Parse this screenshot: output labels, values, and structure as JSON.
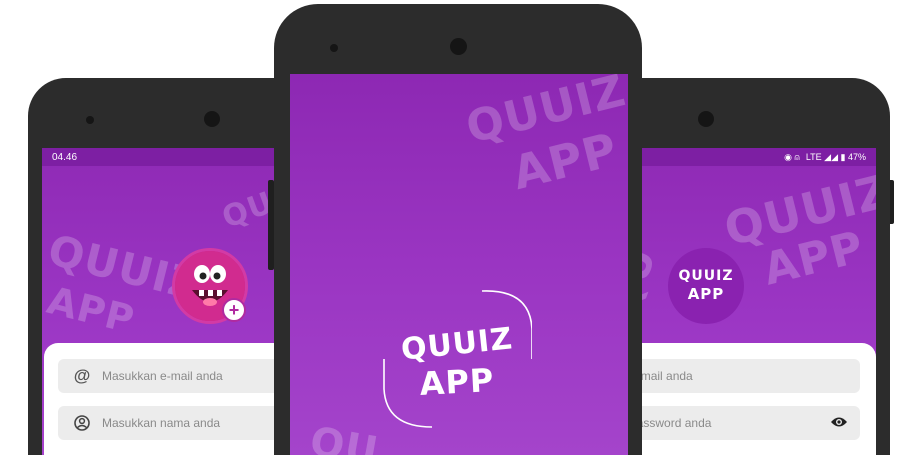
{
  "left_phone": {
    "status_time": "04.46",
    "email_placeholder": "Masukkan e-mail anda",
    "name_placeholder": "Masukkan nama anda"
  },
  "center_phone": {
    "logo_line1": "QUUIZ",
    "logo_line2": "APP",
    "watermark_line1": "QUUIZ",
    "watermark_line2": "APP"
  },
  "right_phone": {
    "status_right": "LTE ◢◢ ▮ 47%",
    "logo_line1": "QUUIZ",
    "logo_line2": "APP",
    "email_placeholder": "Masukkan e-mail anda",
    "password_placeholder": "Masukkan password anda",
    "watermark_line1": "QUUIZ",
    "watermark_line2": "APP"
  },
  "icons": {
    "at": "at-icon",
    "user": "user-circle-icon",
    "eye": "eye-icon",
    "plus": "plus-icon"
  }
}
